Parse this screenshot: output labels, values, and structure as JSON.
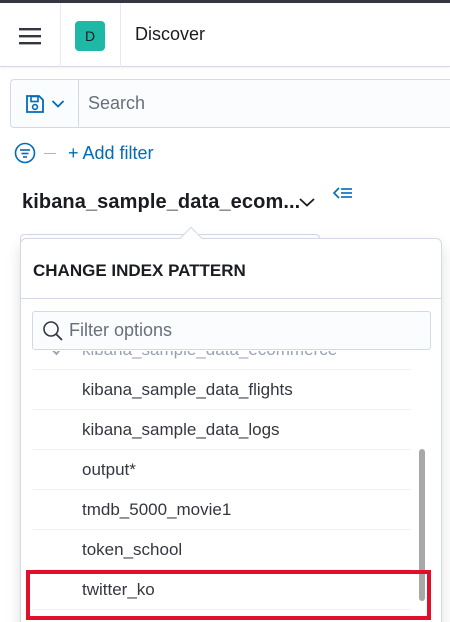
{
  "header": {
    "app_title": "Discover",
    "space_initial": "D",
    "space_color": "#1fb7a6",
    "icons": {
      "menu": "hamburger-menu-icon"
    }
  },
  "query_bar": {
    "save_icon": "floppy-disk-icon",
    "dropdown_icon": "chevron-down-icon",
    "search_placeholder": "Search"
  },
  "filter_bar": {
    "filter_icon": "filter-icon",
    "add_filter_label": "+ Add filter"
  },
  "index_pattern": {
    "selected": "kibana_sample_data_ecom...",
    "dropdown_icon": "chevron-down-icon",
    "collapse_icon": "collapse-left-icon"
  },
  "popover": {
    "title": "CHANGE INDEX PATTERN",
    "filter_placeholder": "Filter options",
    "options": [
      {
        "label": "kibana_sample_data_ecommerce",
        "checked": true
      },
      {
        "label": "kibana_sample_data_flights",
        "checked": false
      },
      {
        "label": "kibana_sample_data_logs",
        "checked": false
      },
      {
        "label": "output*",
        "checked": false
      },
      {
        "label": "tmdb_5000_movie1",
        "checked": false
      },
      {
        "label": "token_school",
        "checked": false
      },
      {
        "label": "twitter_ko",
        "checked": false
      }
    ],
    "highlighted_option": "twitter_ko",
    "highlight_color": "#e0102a"
  },
  "colors": {
    "link": "#006bb8",
    "border": "#d3dae6",
    "text": "#343741"
  }
}
